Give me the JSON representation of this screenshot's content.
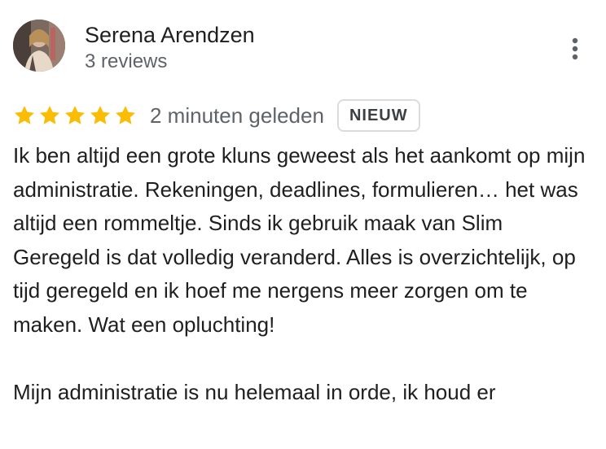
{
  "author": {
    "name": "Serena Arendzen",
    "reviews_count": "3 reviews",
    "avatar_icon": "avatar-photo"
  },
  "menu": {
    "icon": "more-vert-icon"
  },
  "review": {
    "rating": 5,
    "rating_max": 5,
    "star_color": "#fbbc04",
    "timestamp": "2 minuten geleden",
    "badge": "NIEUW",
    "paragraphs": [
      "Ik ben altijd een grote kluns geweest als het aankomt op mijn administratie. Rekeningen, deadlines, formulieren… het was altijd een rommeltje. Sinds ik gebruik maak van Slim Geregeld is dat volledig veranderd. Alles is overzichtelijk, op tijd geregeld en ik hoef me nergens meer zorgen om te maken. Wat een opluchting!",
      "Mijn administratie is nu helemaal in orde, ik houd er"
    ]
  }
}
